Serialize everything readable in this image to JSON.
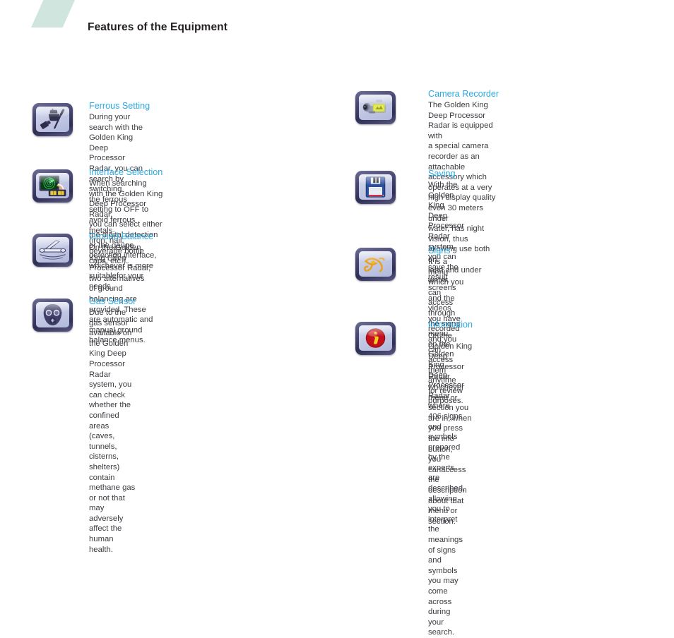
{
  "header": {
    "title": "Features of the Equipment",
    "accent_color": "#cfe5de",
    "title_color": "#231f20"
  },
  "theme": {
    "heading_color": "#2ba9e3",
    "body_color": "#3b3b41",
    "icon_frame_color": "#2f2f55",
    "icon_face_color": "#c3c9e4",
    "background": "#ffffff"
  },
  "left_column": {
    "items": [
      {
        "icon": "magnet-nail-icon",
        "heading": "Ferrous Setting",
        "body": "During your search with the Golden King Deep\nProcessor Radar, you can search by switching\nthe ferrous setting to OFF to avoid ferrous metals\n(iron, nail, beverage bottle caps, etc.)."
      },
      {
        "icon": "radar-screen-icon",
        "heading": "Interface Selection",
        "body": "When searching with the Golden King Deep Processor Radar,\nyou can select either the digital detection or the gauge\ndetection interface, whichever is more suitablefor your needs."
      },
      {
        "icon": "search-coil-icon",
        "heading": "Ground Balance",
        "body": "On the Golden King Deep Processor Radar, two alternatives\nof ground balancing are provided. These are automatic and\nmanual ground balance menus."
      },
      {
        "icon": "gas-mask-icon",
        "heading": "Gas Sensor",
        "body": "Due to the gas sensor available on the Golden King Deep\nProcessor Radar system, you can check whether the\nconfined areas (caves, tunnels, cisterns, shelters) contain\nmethane gas or not that may adversely affect the human\nhealth."
      }
    ]
  },
  "right_column": {
    "items": [
      {
        "icon": "camcorder-icon",
        "heading": "Camera Recorder",
        "body": "The Golden King Deep Processor Radar is equipped with\na special camera recorder as an attachable accessory which\noperates at a very high display quality even 30 meters under\nwater, has night vision, thus allowing use both on\nland and under water."
      },
      {
        "icon": "floppy-disk-icon",
        "heading": "Saving",
        "body": "With the Golden King Deep Processor Radar system,\nyou can save the result screens and the videos you have\nrecorded and you can access them anytime for review\npurposes."
      },
      {
        "icon": "eye-of-horus-icon",
        "heading": "Signs",
        "body": "It is a menu which you can access through the signs menu\non the Golden King Deep Processor Radar where 406 signs\nand symbols prepared by the experts are described, allowing\nyou to interpret the meanings of signs and symbols you may\ncome across during your search."
      },
      {
        "icon": "info-badge-icon",
        "heading": "Information",
        "body": "On the Golden King Deep Processor Radar, whichever\nmenu or section you are in, when you press the info button,\nyou canaccess the description about that menu or section."
      }
    ]
  }
}
